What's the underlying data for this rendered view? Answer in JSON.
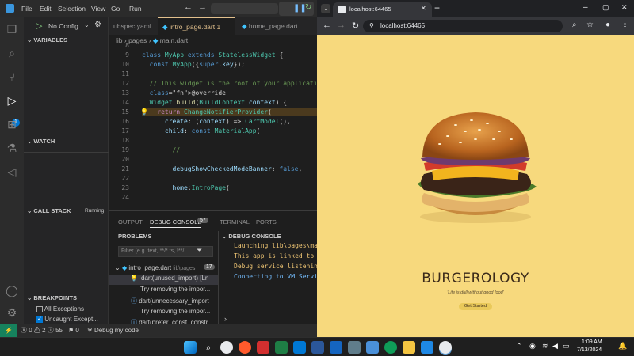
{
  "vscode": {
    "menu": [
      "File",
      "Edit",
      "Selection",
      "View",
      "Go",
      "Run"
    ],
    "nav_back": "←",
    "nav_forward": "→",
    "run_config": "No Config",
    "activity_badge": "1",
    "sidebar": {
      "variables": "VARIABLES",
      "watch": "WATCH",
      "call_stack": "CALL STACK",
      "call_stack_status": "Running",
      "breakpoints": "BREAKPOINTS",
      "bp_all_exceptions": "All Exceptions",
      "bp_uncaught": "Uncaught Except..."
    },
    "tabs": [
      "ubspec.yaml",
      "intro_page.dart 1",
      "home_page.dart"
    ],
    "active_tab": "intro_page.dart 1",
    "breadcrumb": [
      "lib",
      "pages",
      "main.dart"
    ],
    "code_lines": [
      {
        "n": "8",
        "text": ""
      },
      {
        "n": "9",
        "text": "class MyApp extends StatelessWidget {"
      },
      {
        "n": "10",
        "text": "  const MyApp({super.key});"
      },
      {
        "n": "11",
        "text": ""
      },
      {
        "n": "12",
        "text": "  // This widget is the root of your applicati"
      },
      {
        "n": "13",
        "text": "  @override"
      },
      {
        "n": "14",
        "text": "  Widget build(BuildContext context) {"
      },
      {
        "n": "15",
        "text": "    return ChangeNotifierProvider("
      },
      {
        "n": "16",
        "text": "      create: (context) => CartModel(),"
      },
      {
        "n": "17",
        "text": "      child: const MaterialApp("
      },
      {
        "n": "18",
        "text": ""
      },
      {
        "n": "19",
        "text": "        //"
      },
      {
        "n": "20",
        "text": ""
      },
      {
        "n": "21",
        "text": "        debugShowCheckedModeBanner: false,"
      },
      {
        "n": "22",
        "text": ""
      },
      {
        "n": "23",
        "text": "        home:IntroPage("
      },
      {
        "n": "24",
        "text": ""
      }
    ],
    "panel_tabs": [
      "OUTPUT",
      "DEBUG CONSOLE",
      "TERMINAL",
      "PORTS"
    ],
    "debug_console_count": "57",
    "problems_header": "PROBLEMS",
    "debug_console_header": "DEBUG CONSOLE",
    "filter_placeholder": "Filter (e.g. text, **/*.ts, !**/...",
    "problems_file": "intro_page.dart",
    "problems_file_path": "lib\\pages",
    "problems_count": "17",
    "problems": [
      {
        "text": "dart(unused_import) [Ln",
        "code": "unused_import"
      },
      {
        "text": "Try removing the impor..."
      },
      {
        "text": "dart(unnecessary_import",
        "code": "unnecessary_import"
      },
      {
        "text": "Try removing the impor..."
      },
      {
        "text": "dart(prefer_const_constr",
        "code": "prefer_const_constr"
      }
    ],
    "console_lines": [
      "Launching lib\\pages\\ma",
      "This app is linked to",
      "Debug service listenin",
      "Connecting to VM Servi"
    ],
    "status": {
      "errors": "0",
      "warnings": "2",
      "info": "55",
      "ports": "0",
      "debug": "Debug my code"
    }
  },
  "chrome": {
    "tab_title": "localhost:64465",
    "new_tab": "+",
    "url": "localhost:64465",
    "window_controls": [
      "–",
      "▢",
      "✕"
    ]
  },
  "app": {
    "title": "BURGEROLOGY",
    "tagline": "'Life is dull without good food'",
    "cta": "Get Started"
  },
  "taskbar": {
    "time": "1:09 AM",
    "date": "7/13/2024"
  },
  "colors": {
    "page_bg": "#f7d97d",
    "vscode_bg": "#1e1e1e",
    "title_brown": "#3b2a1a",
    "cta_bg": "#e9c95a"
  }
}
